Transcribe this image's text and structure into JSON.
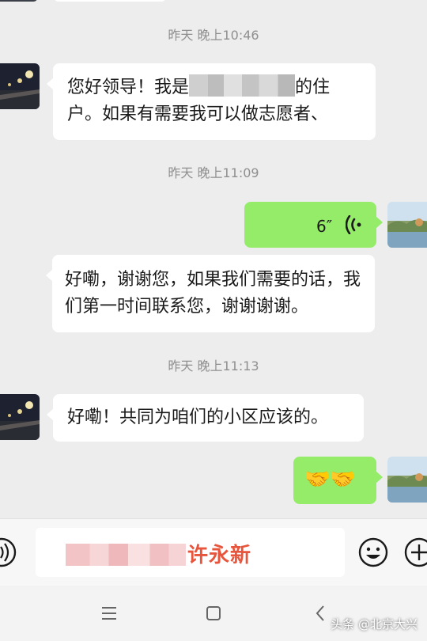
{
  "messages": [
    {
      "time": "昨天 晚上10:46",
      "direction": "incoming",
      "text_prefix": "您好领导！我是",
      "text_suffix": "的住户。如果有需要我可以做志愿者、"
    },
    {
      "time": "昨天 晚上11:09",
      "direction": "outgoing",
      "type": "voice",
      "duration": "6″"
    },
    {
      "direction": "incoming",
      "text": "好嘞，谢谢您，如果我们需要的话，我们第一时间联系您，谢谢谢谢。"
    },
    {
      "time": "昨天 晚上11:13",
      "direction": "incoming",
      "text": "好嘞！共同为咱们的小区应该的。"
    },
    {
      "direction": "outgoing",
      "type": "emoji",
      "emoji": "🤝🤝"
    }
  ],
  "input": {
    "visible_text": "许永新"
  },
  "icons": {
    "voice_toggle": "voice-icon",
    "emoji": "emoji-icon",
    "more": "plus-icon",
    "voice_message": "voice-wave-icon",
    "nav_menu": "menu-icon",
    "nav_home": "home-icon",
    "nav_back": "back-icon"
  },
  "colors": {
    "outgoing_bubble": "#95ec69",
    "incoming_bubble": "#ffffff",
    "background": "#ededed",
    "input_text": "#e8553d"
  },
  "watermark": "头条 @北京大兴"
}
